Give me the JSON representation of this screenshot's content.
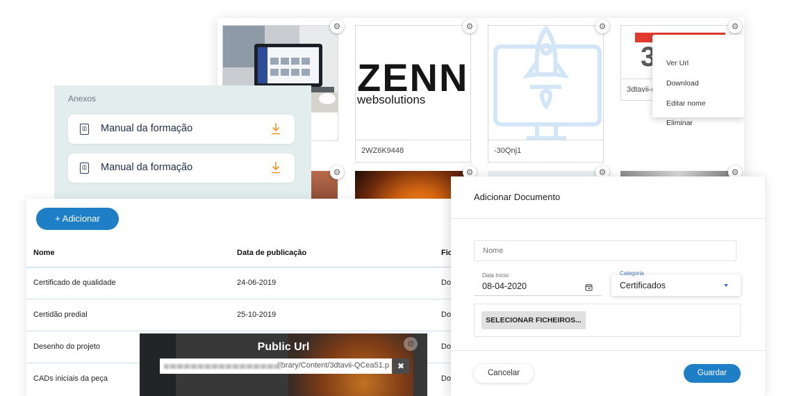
{
  "gallery": {
    "tiles": [
      {
        "caption": ""
      },
      {
        "caption": "2WZ6K9448"
      },
      {
        "caption": "-30Qnj1"
      },
      {
        "caption": "3dtavii-("
      }
    ],
    "logo": {
      "line1": "ZENN:",
      "line2": "websolutions"
    },
    "gear_glyph": "⚙",
    "context_menu": [
      "Ver Url",
      "Download",
      "Editar nome",
      "Eliminar"
    ]
  },
  "anexos": {
    "title": "Anexos",
    "items": [
      {
        "name": "Manual da formação",
        "icon": "pdf-icon"
      },
      {
        "name": "Manual da formação",
        "icon": "pdf-icon"
      }
    ],
    "accent": "#e8952a"
  },
  "list": {
    "add_label": "+ Adicionar",
    "columns": [
      "Nome",
      "Data de publicação",
      "Fic"
    ],
    "rows": [
      {
        "name": "Certificado de qualidade",
        "date": "24-06-2019",
        "file": "Do"
      },
      {
        "name": "Certidão predial",
        "date": "25-10-2019",
        "file": "Do"
      },
      {
        "name": "Desenho do projeto",
        "date": "",
        "file": "Do"
      },
      {
        "name": "CADs iniciais da peça",
        "date": "",
        "file": "Do"
      }
    ],
    "accent": "#1f7fc6"
  },
  "public_url": {
    "title": "Public Url",
    "url_visible": "library/Content/3dtavii-QCea51.p",
    "close_glyph": "✖"
  },
  "dialog": {
    "title": "Adicionar Documento",
    "name_placeholder": "Nome",
    "date_label": "Data Início",
    "date_value": "08-04-2020",
    "category_label": "Categoria",
    "category_value": "Certificados",
    "files_button": "SELECIONAR FICHEIROS...",
    "cancel": "Cancelar",
    "save": "Guardar"
  }
}
